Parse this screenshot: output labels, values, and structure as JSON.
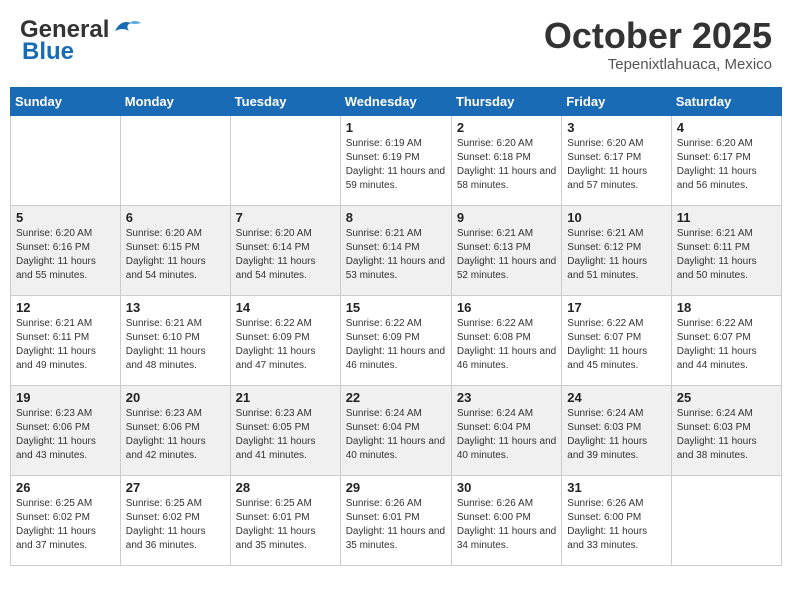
{
  "header": {
    "logo_general": "General",
    "logo_blue": "Blue",
    "month": "October 2025",
    "location": "Tepenixtlahuaca, Mexico"
  },
  "days_of_week": [
    "Sunday",
    "Monday",
    "Tuesday",
    "Wednesday",
    "Thursday",
    "Friday",
    "Saturday"
  ],
  "weeks": [
    [
      {
        "day": "",
        "sunrise": "",
        "sunset": "",
        "daylight": ""
      },
      {
        "day": "",
        "sunrise": "",
        "sunset": "",
        "daylight": ""
      },
      {
        "day": "",
        "sunrise": "",
        "sunset": "",
        "daylight": ""
      },
      {
        "day": "1",
        "sunrise": "Sunrise: 6:19 AM",
        "sunset": "Sunset: 6:19 PM",
        "daylight": "Daylight: 11 hours and 59 minutes."
      },
      {
        "day": "2",
        "sunrise": "Sunrise: 6:20 AM",
        "sunset": "Sunset: 6:18 PM",
        "daylight": "Daylight: 11 hours and 58 minutes."
      },
      {
        "day": "3",
        "sunrise": "Sunrise: 6:20 AM",
        "sunset": "Sunset: 6:17 PM",
        "daylight": "Daylight: 11 hours and 57 minutes."
      },
      {
        "day": "4",
        "sunrise": "Sunrise: 6:20 AM",
        "sunset": "Sunset: 6:17 PM",
        "daylight": "Daylight: 11 hours and 56 minutes."
      }
    ],
    [
      {
        "day": "5",
        "sunrise": "Sunrise: 6:20 AM",
        "sunset": "Sunset: 6:16 PM",
        "daylight": "Daylight: 11 hours and 55 minutes."
      },
      {
        "day": "6",
        "sunrise": "Sunrise: 6:20 AM",
        "sunset": "Sunset: 6:15 PM",
        "daylight": "Daylight: 11 hours and 54 minutes."
      },
      {
        "day": "7",
        "sunrise": "Sunrise: 6:20 AM",
        "sunset": "Sunset: 6:14 PM",
        "daylight": "Daylight: 11 hours and 54 minutes."
      },
      {
        "day": "8",
        "sunrise": "Sunrise: 6:21 AM",
        "sunset": "Sunset: 6:14 PM",
        "daylight": "Daylight: 11 hours and 53 minutes."
      },
      {
        "day": "9",
        "sunrise": "Sunrise: 6:21 AM",
        "sunset": "Sunset: 6:13 PM",
        "daylight": "Daylight: 11 hours and 52 minutes."
      },
      {
        "day": "10",
        "sunrise": "Sunrise: 6:21 AM",
        "sunset": "Sunset: 6:12 PM",
        "daylight": "Daylight: 11 hours and 51 minutes."
      },
      {
        "day": "11",
        "sunrise": "Sunrise: 6:21 AM",
        "sunset": "Sunset: 6:11 PM",
        "daylight": "Daylight: 11 hours and 50 minutes."
      }
    ],
    [
      {
        "day": "12",
        "sunrise": "Sunrise: 6:21 AM",
        "sunset": "Sunset: 6:11 PM",
        "daylight": "Daylight: 11 hours and 49 minutes."
      },
      {
        "day": "13",
        "sunrise": "Sunrise: 6:21 AM",
        "sunset": "Sunset: 6:10 PM",
        "daylight": "Daylight: 11 hours and 48 minutes."
      },
      {
        "day": "14",
        "sunrise": "Sunrise: 6:22 AM",
        "sunset": "Sunset: 6:09 PM",
        "daylight": "Daylight: 11 hours and 47 minutes."
      },
      {
        "day": "15",
        "sunrise": "Sunrise: 6:22 AM",
        "sunset": "Sunset: 6:09 PM",
        "daylight": "Daylight: 11 hours and 46 minutes."
      },
      {
        "day": "16",
        "sunrise": "Sunrise: 6:22 AM",
        "sunset": "Sunset: 6:08 PM",
        "daylight": "Daylight: 11 hours and 46 minutes."
      },
      {
        "day": "17",
        "sunrise": "Sunrise: 6:22 AM",
        "sunset": "Sunset: 6:07 PM",
        "daylight": "Daylight: 11 hours and 45 minutes."
      },
      {
        "day": "18",
        "sunrise": "Sunrise: 6:22 AM",
        "sunset": "Sunset: 6:07 PM",
        "daylight": "Daylight: 11 hours and 44 minutes."
      }
    ],
    [
      {
        "day": "19",
        "sunrise": "Sunrise: 6:23 AM",
        "sunset": "Sunset: 6:06 PM",
        "daylight": "Daylight: 11 hours and 43 minutes."
      },
      {
        "day": "20",
        "sunrise": "Sunrise: 6:23 AM",
        "sunset": "Sunset: 6:06 PM",
        "daylight": "Daylight: 11 hours and 42 minutes."
      },
      {
        "day": "21",
        "sunrise": "Sunrise: 6:23 AM",
        "sunset": "Sunset: 6:05 PM",
        "daylight": "Daylight: 11 hours and 41 minutes."
      },
      {
        "day": "22",
        "sunrise": "Sunrise: 6:24 AM",
        "sunset": "Sunset: 6:04 PM",
        "daylight": "Daylight: 11 hours and 40 minutes."
      },
      {
        "day": "23",
        "sunrise": "Sunrise: 6:24 AM",
        "sunset": "Sunset: 6:04 PM",
        "daylight": "Daylight: 11 hours and 40 minutes."
      },
      {
        "day": "24",
        "sunrise": "Sunrise: 6:24 AM",
        "sunset": "Sunset: 6:03 PM",
        "daylight": "Daylight: 11 hours and 39 minutes."
      },
      {
        "day": "25",
        "sunrise": "Sunrise: 6:24 AM",
        "sunset": "Sunset: 6:03 PM",
        "daylight": "Daylight: 11 hours and 38 minutes."
      }
    ],
    [
      {
        "day": "26",
        "sunrise": "Sunrise: 6:25 AM",
        "sunset": "Sunset: 6:02 PM",
        "daylight": "Daylight: 11 hours and 37 minutes."
      },
      {
        "day": "27",
        "sunrise": "Sunrise: 6:25 AM",
        "sunset": "Sunset: 6:02 PM",
        "daylight": "Daylight: 11 hours and 36 minutes."
      },
      {
        "day": "28",
        "sunrise": "Sunrise: 6:25 AM",
        "sunset": "Sunset: 6:01 PM",
        "daylight": "Daylight: 11 hours and 35 minutes."
      },
      {
        "day": "29",
        "sunrise": "Sunrise: 6:26 AM",
        "sunset": "Sunset: 6:01 PM",
        "daylight": "Daylight: 11 hours and 35 minutes."
      },
      {
        "day": "30",
        "sunrise": "Sunrise: 6:26 AM",
        "sunset": "Sunset: 6:00 PM",
        "daylight": "Daylight: 11 hours and 34 minutes."
      },
      {
        "day": "31",
        "sunrise": "Sunrise: 6:26 AM",
        "sunset": "Sunset: 6:00 PM",
        "daylight": "Daylight: 11 hours and 33 minutes."
      },
      {
        "day": "",
        "sunrise": "",
        "sunset": "",
        "daylight": ""
      }
    ]
  ]
}
